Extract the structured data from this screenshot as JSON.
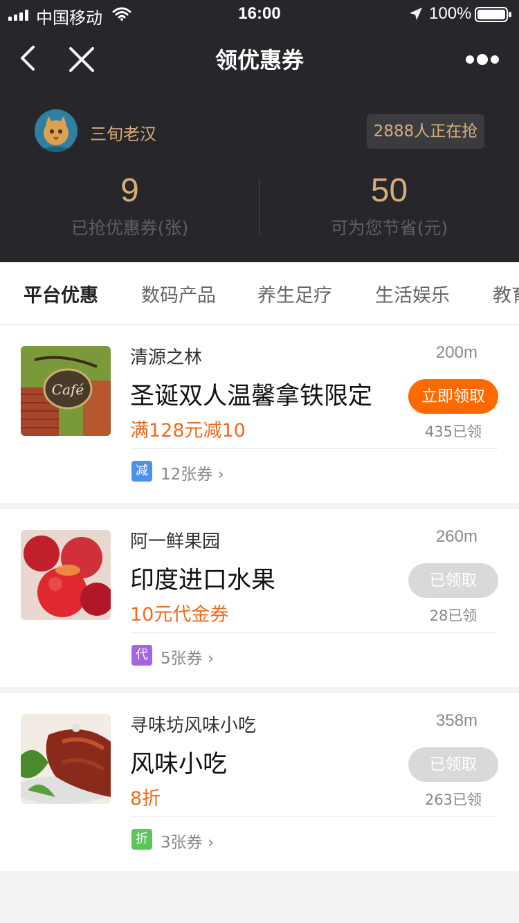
{
  "status_bar": {
    "carrier": "中国移动",
    "time": "16:00",
    "battery": "100%"
  },
  "nav": {
    "title": "领优惠券"
  },
  "user": {
    "name": "三旬老汉",
    "grab_count": "2888人正在抢"
  },
  "stats": {
    "coupons_count": "9",
    "coupons_label": "已抢优惠券(张)",
    "save_amount": "50",
    "save_label": "可为您节省(元)"
  },
  "tabs": [
    "平台优惠",
    "数码产品",
    "养生足疗",
    "生活娱乐",
    "教育"
  ],
  "coupons": [
    {
      "shop": "清源之林",
      "distance": "200m",
      "product": "圣诞双人温馨拿铁限定",
      "offer": "满128元减10",
      "button": "立即领取",
      "claimed": "435已领",
      "tag": "减",
      "tag_color": "#4d8ff0",
      "tag_text": "12张券",
      "thumb": "cafe-sign"
    },
    {
      "shop": "阿一鲜果园",
      "distance": "260m",
      "product": "印度进口水果",
      "offer": "10元代金券",
      "button": "已领取",
      "claimed": "28已领",
      "tag": "代",
      "tag_color": "#a465e0",
      "tag_text": "5张券",
      "thumb": "red-fruits"
    },
    {
      "shop": "寻味坊风味小吃",
      "distance": "358m",
      "product": "风味小吃",
      "offer": "8折",
      "button": "已领取",
      "claimed": "263已领",
      "tag": "折",
      "tag_color": "#5cc55a",
      "tag_text": "3张券",
      "thumb": "roast-meat"
    }
  ],
  "colors": {
    "accent": "#ff6a00",
    "gold": "#d7ad78",
    "header_bg": "#26262b"
  }
}
